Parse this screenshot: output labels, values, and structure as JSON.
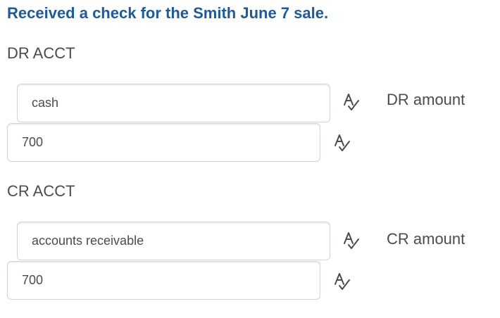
{
  "question": {
    "title": "Received a check for the Smith June 7 sale."
  },
  "debit": {
    "section_label": "DR ACCT",
    "account_value": "cash",
    "amount_value": "700",
    "amount_label": "DR amount"
  },
  "credit": {
    "section_label": "CR ACCT",
    "account_value": "accounts receivable",
    "amount_value": "700",
    "amount_label": "CR amount"
  },
  "icons": {
    "spellcheck": "spellcheck-icon"
  },
  "colors": {
    "title": "#1f5a96",
    "text": "#494c4e",
    "border": "#cdd5dc"
  }
}
